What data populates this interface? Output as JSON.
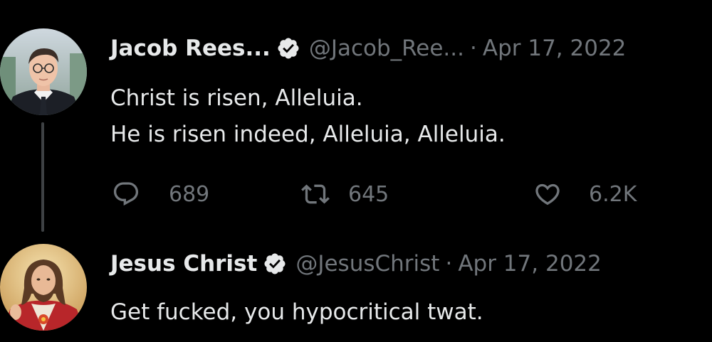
{
  "colors": {
    "background": "#000000",
    "primary_text": "#e7e9ea",
    "secondary_text": "#71767b",
    "verified_badge": "#e7e9ea",
    "thread_line": "#3e4144"
  },
  "tweets": [
    {
      "avatar_icon": "person-avatar-photo",
      "display_name": "Jacob Rees...",
      "verified_icon": "verified-badge-icon",
      "handle": "@Jacob_Ree...",
      "separator": "·",
      "date": "Apr 17, 2022",
      "text_lines": [
        "Christ is risen, Alleluia.",
        "He is risen indeed, Alleluia, Alleluia."
      ],
      "stats": {
        "replies": "689",
        "retweets": "645",
        "likes": "6.2K"
      }
    },
    {
      "avatar_icon": "jesus-portrait-avatar",
      "display_name": "Jesus Christ",
      "verified_icon": "verified-badge-icon",
      "handle": "@JesusChrist",
      "separator": "·",
      "date": "Apr 17, 2022",
      "text_lines": [
        "Get fucked, you hypocritical twat."
      ]
    }
  ]
}
